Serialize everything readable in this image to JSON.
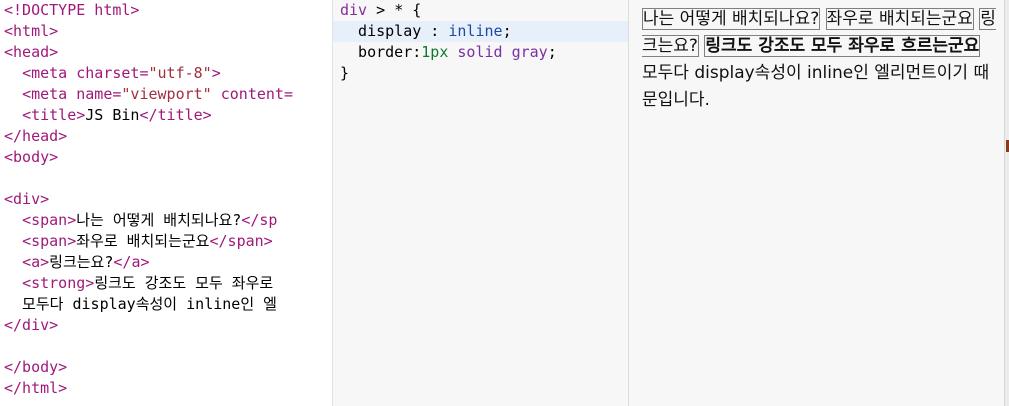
{
  "html_editor": {
    "lines": [
      [
        {
          "t": "<!DOCTYPE html>",
          "c": "tag"
        }
      ],
      [
        {
          "t": "<html>",
          "c": "tag"
        }
      ],
      [
        {
          "t": "<head>",
          "c": "tag"
        }
      ],
      [
        {
          "t": "  ",
          "c": "txt"
        },
        {
          "t": "<meta ",
          "c": "tag"
        },
        {
          "t": "charset=",
          "c": "attr"
        },
        {
          "t": "\"utf-8\"",
          "c": "str"
        },
        {
          "t": ">",
          "c": "tag"
        }
      ],
      [
        {
          "t": "  ",
          "c": "txt"
        },
        {
          "t": "<meta ",
          "c": "tag"
        },
        {
          "t": "name=",
          "c": "attr"
        },
        {
          "t": "\"viewport\"",
          "c": "str"
        },
        {
          "t": " content=",
          "c": "attr"
        }
      ],
      [
        {
          "t": "  ",
          "c": "txt"
        },
        {
          "t": "<title>",
          "c": "tag"
        },
        {
          "t": "JS Bin",
          "c": "txt"
        },
        {
          "t": "</title>",
          "c": "tag"
        }
      ],
      [
        {
          "t": "</head>",
          "c": "tag"
        }
      ],
      [
        {
          "t": "<body>",
          "c": "tag"
        }
      ],
      [
        {
          "t": "",
          "c": "txt"
        }
      ],
      [
        {
          "t": "<div>",
          "c": "tag"
        }
      ],
      [
        {
          "t": "  ",
          "c": "txt"
        },
        {
          "t": "<span>",
          "c": "tag"
        },
        {
          "t": "나는 어떻게 배치되나요?",
          "c": "txt"
        },
        {
          "t": "</sp",
          "c": "tag"
        }
      ],
      [
        {
          "t": "  ",
          "c": "txt"
        },
        {
          "t": "<span>",
          "c": "tag"
        },
        {
          "t": "좌우로 배치되는군요",
          "c": "txt"
        },
        {
          "t": "</span>",
          "c": "tag"
        }
      ],
      [
        {
          "t": "  ",
          "c": "txt"
        },
        {
          "t": "<a>",
          "c": "tag"
        },
        {
          "t": "링크는요?",
          "c": "txt"
        },
        {
          "t": "</a>",
          "c": "tag"
        }
      ],
      [
        {
          "t": "  ",
          "c": "txt"
        },
        {
          "t": "<strong>",
          "c": "tag"
        },
        {
          "t": "링크도 강조도 모두 좌우로",
          "c": "txt"
        }
      ],
      [
        {
          "t": "  모두다 display속성이 inline인 엘",
          "c": "txt"
        }
      ],
      [
        {
          "t": "</div>",
          "c": "tag"
        }
      ],
      [
        {
          "t": "",
          "c": "txt"
        }
      ],
      [
        {
          "t": "</body>",
          "c": "tag"
        }
      ],
      [
        {
          "t": "</html>",
          "c": "tag"
        }
      ]
    ]
  },
  "css_editor": {
    "lines": [
      [
        {
          "t": "div",
          "c": "sel"
        },
        {
          "t": " > ",
          "c": "punc"
        },
        {
          "t": "*",
          "c": "punc"
        },
        {
          "t": " {",
          "c": "punc"
        }
      ],
      [
        {
          "t": "  display",
          "c": "prop"
        },
        {
          "t": " : ",
          "c": "punc"
        },
        {
          "t": "inline",
          "c": "val"
        },
        {
          "t": ";",
          "c": "punc"
        }
      ],
      [
        {
          "t": "  border",
          "c": "prop"
        },
        {
          "t": ":",
          "c": "punc"
        },
        {
          "t": "1px",
          "c": "num"
        },
        {
          "t": " solid ",
          "c": "kw"
        },
        {
          "t": "gray",
          "c": "kw"
        },
        {
          "t": ";",
          "c": "punc"
        }
      ],
      [
        {
          "t": "}",
          "c": "punc"
        }
      ]
    ],
    "active_line": 1
  },
  "output": {
    "span1": "나는 어떻게 배치되나요?",
    "span2": "좌우로 배치되는군요",
    "link": "링크는요?",
    "strong": "링크도 강조도 모두 좌우로 흐르는군요",
    "trailing": "모두다 display속성이 inline인 엘리먼트이기 때문입니다."
  }
}
